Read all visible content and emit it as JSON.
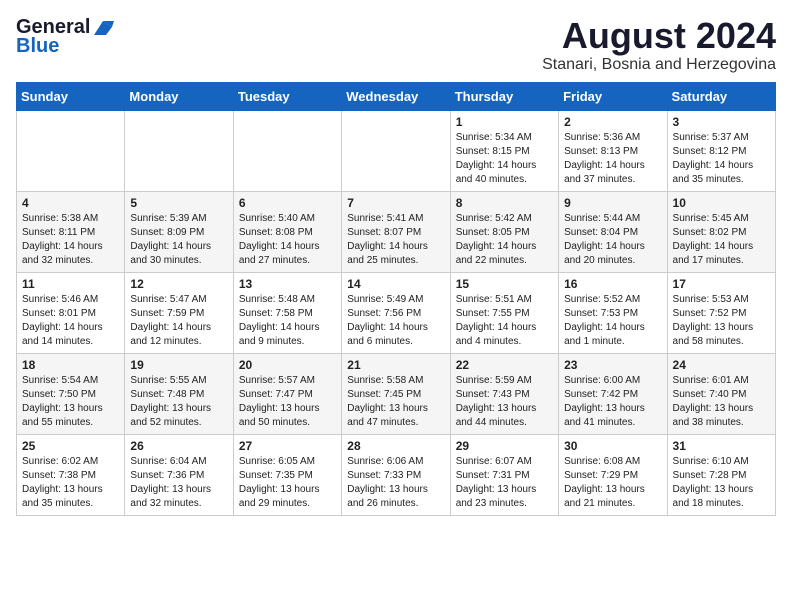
{
  "header": {
    "logo_line1": "General",
    "logo_line2": "Blue",
    "month_year": "August 2024",
    "location": "Stanari, Bosnia and Herzegovina"
  },
  "weekdays": [
    "Sunday",
    "Monday",
    "Tuesday",
    "Wednesday",
    "Thursday",
    "Friday",
    "Saturday"
  ],
  "weeks": [
    [
      {
        "day": "",
        "info": ""
      },
      {
        "day": "",
        "info": ""
      },
      {
        "day": "",
        "info": ""
      },
      {
        "day": "",
        "info": ""
      },
      {
        "day": "1",
        "info": "Sunrise: 5:34 AM\nSunset: 8:15 PM\nDaylight: 14 hours\nand 40 minutes."
      },
      {
        "day": "2",
        "info": "Sunrise: 5:36 AM\nSunset: 8:13 PM\nDaylight: 14 hours\nand 37 minutes."
      },
      {
        "day": "3",
        "info": "Sunrise: 5:37 AM\nSunset: 8:12 PM\nDaylight: 14 hours\nand 35 minutes."
      }
    ],
    [
      {
        "day": "4",
        "info": "Sunrise: 5:38 AM\nSunset: 8:11 PM\nDaylight: 14 hours\nand 32 minutes."
      },
      {
        "day": "5",
        "info": "Sunrise: 5:39 AM\nSunset: 8:09 PM\nDaylight: 14 hours\nand 30 minutes."
      },
      {
        "day": "6",
        "info": "Sunrise: 5:40 AM\nSunset: 8:08 PM\nDaylight: 14 hours\nand 27 minutes."
      },
      {
        "day": "7",
        "info": "Sunrise: 5:41 AM\nSunset: 8:07 PM\nDaylight: 14 hours\nand 25 minutes."
      },
      {
        "day": "8",
        "info": "Sunrise: 5:42 AM\nSunset: 8:05 PM\nDaylight: 14 hours\nand 22 minutes."
      },
      {
        "day": "9",
        "info": "Sunrise: 5:44 AM\nSunset: 8:04 PM\nDaylight: 14 hours\nand 20 minutes."
      },
      {
        "day": "10",
        "info": "Sunrise: 5:45 AM\nSunset: 8:02 PM\nDaylight: 14 hours\nand 17 minutes."
      }
    ],
    [
      {
        "day": "11",
        "info": "Sunrise: 5:46 AM\nSunset: 8:01 PM\nDaylight: 14 hours\nand 14 minutes."
      },
      {
        "day": "12",
        "info": "Sunrise: 5:47 AM\nSunset: 7:59 PM\nDaylight: 14 hours\nand 12 minutes."
      },
      {
        "day": "13",
        "info": "Sunrise: 5:48 AM\nSunset: 7:58 PM\nDaylight: 14 hours\nand 9 minutes."
      },
      {
        "day": "14",
        "info": "Sunrise: 5:49 AM\nSunset: 7:56 PM\nDaylight: 14 hours\nand 6 minutes."
      },
      {
        "day": "15",
        "info": "Sunrise: 5:51 AM\nSunset: 7:55 PM\nDaylight: 14 hours\nand 4 minutes."
      },
      {
        "day": "16",
        "info": "Sunrise: 5:52 AM\nSunset: 7:53 PM\nDaylight: 14 hours\nand 1 minute."
      },
      {
        "day": "17",
        "info": "Sunrise: 5:53 AM\nSunset: 7:52 PM\nDaylight: 13 hours\nand 58 minutes."
      }
    ],
    [
      {
        "day": "18",
        "info": "Sunrise: 5:54 AM\nSunset: 7:50 PM\nDaylight: 13 hours\nand 55 minutes."
      },
      {
        "day": "19",
        "info": "Sunrise: 5:55 AM\nSunset: 7:48 PM\nDaylight: 13 hours\nand 52 minutes."
      },
      {
        "day": "20",
        "info": "Sunrise: 5:57 AM\nSunset: 7:47 PM\nDaylight: 13 hours\nand 50 minutes."
      },
      {
        "day": "21",
        "info": "Sunrise: 5:58 AM\nSunset: 7:45 PM\nDaylight: 13 hours\nand 47 minutes."
      },
      {
        "day": "22",
        "info": "Sunrise: 5:59 AM\nSunset: 7:43 PM\nDaylight: 13 hours\nand 44 minutes."
      },
      {
        "day": "23",
        "info": "Sunrise: 6:00 AM\nSunset: 7:42 PM\nDaylight: 13 hours\nand 41 minutes."
      },
      {
        "day": "24",
        "info": "Sunrise: 6:01 AM\nSunset: 7:40 PM\nDaylight: 13 hours\nand 38 minutes."
      }
    ],
    [
      {
        "day": "25",
        "info": "Sunrise: 6:02 AM\nSunset: 7:38 PM\nDaylight: 13 hours\nand 35 minutes."
      },
      {
        "day": "26",
        "info": "Sunrise: 6:04 AM\nSunset: 7:36 PM\nDaylight: 13 hours\nand 32 minutes."
      },
      {
        "day": "27",
        "info": "Sunrise: 6:05 AM\nSunset: 7:35 PM\nDaylight: 13 hours\nand 29 minutes."
      },
      {
        "day": "28",
        "info": "Sunrise: 6:06 AM\nSunset: 7:33 PM\nDaylight: 13 hours\nand 26 minutes."
      },
      {
        "day": "29",
        "info": "Sunrise: 6:07 AM\nSunset: 7:31 PM\nDaylight: 13 hours\nand 23 minutes."
      },
      {
        "day": "30",
        "info": "Sunrise: 6:08 AM\nSunset: 7:29 PM\nDaylight: 13 hours\nand 21 minutes."
      },
      {
        "day": "31",
        "info": "Sunrise: 6:10 AM\nSunset: 7:28 PM\nDaylight: 13 hours\nand 18 minutes."
      }
    ]
  ]
}
